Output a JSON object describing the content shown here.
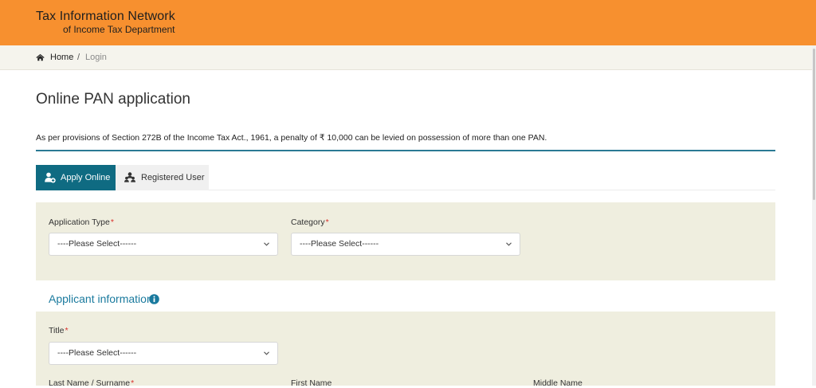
{
  "header": {
    "org_line1": "Tax Information Network",
    "org_line2": "of Income Tax Department",
    "bg_color": "#f7902f"
  },
  "breadcrumb": {
    "home_icon": "home-icon",
    "home": "Home",
    "separator": "/",
    "current": "Login"
  },
  "page": {
    "title": "Online PAN application",
    "notice": "As per provisions of Section 272B of the Income Tax Act., 1961, a penalty of ₹ 10,000 can be levied on possession of more than one PAN."
  },
  "tabs": [
    {
      "label": "Apply Online",
      "icon": "user-add-icon",
      "active": true,
      "active_color": "#0f6b82"
    },
    {
      "label": "Registered User",
      "icon": "user-group-icon",
      "active": false
    }
  ],
  "form": {
    "application_type": {
      "label": "Application Type",
      "required_mark": "*",
      "value": "----Please Select------"
    },
    "category": {
      "label": "Category",
      "required_mark": "*",
      "value": "----Please Select------"
    },
    "applicant_section": {
      "title": "Applicant information",
      "icon": "info-icon"
    },
    "title_field": {
      "label": "Title",
      "required_mark": "*",
      "value": "----Please Select------"
    },
    "last_name": {
      "label": "Last Name / Surname",
      "required_mark": "*"
    },
    "first_name": {
      "label": "First Name"
    },
    "middle_name": {
      "label": "Middle Name"
    }
  }
}
